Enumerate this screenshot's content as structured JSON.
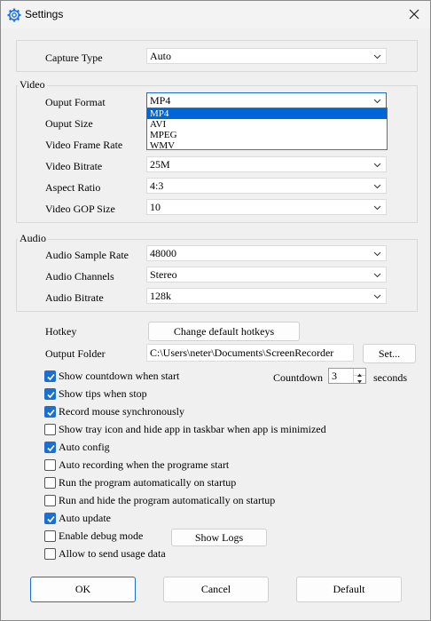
{
  "window": {
    "title": "Settings"
  },
  "capture": {
    "label": "Capture Type",
    "value": "Auto"
  },
  "video": {
    "group_label": "Video",
    "output_format": {
      "label": "Ouput Format",
      "value": "MP4",
      "options": [
        "MP4",
        "AVI",
        "MPEG",
        "WMV"
      ]
    },
    "output_size": {
      "label": "Ouput Size"
    },
    "frame_rate": {
      "label": "Video Frame Rate"
    },
    "bitrate": {
      "label": "Video Bitrate",
      "value": "25M"
    },
    "aspect_ratio": {
      "label": "Aspect Ratio",
      "value": "4:3"
    },
    "gop_size": {
      "label": "Video GOP Size",
      "value": "10"
    }
  },
  "audio": {
    "group_label": "Audio",
    "sample_rate": {
      "label": "Audio Sample Rate",
      "value": "48000"
    },
    "channels": {
      "label": "Audio Channels",
      "value": "Stereo"
    },
    "bitrate": {
      "label": "Audio Bitrate",
      "value": "128k"
    }
  },
  "hotkey": {
    "label": "Hotkey",
    "button": "Change default hotkeys"
  },
  "output_folder": {
    "label": "Output Folder",
    "value": "C:\\Users\\neter\\Documents\\ScreenRecorder",
    "button": "Set..."
  },
  "countdown": {
    "label": "Countdown",
    "value": "3",
    "unit": "seconds"
  },
  "options": [
    {
      "label": "Show countdown when start",
      "checked": true
    },
    {
      "label": "Show tips when stop",
      "checked": true
    },
    {
      "label": "Record mouse synchronously",
      "checked": true
    },
    {
      "label": "Show tray icon and hide app in taskbar when app is minimized",
      "checked": false
    },
    {
      "label": "Auto config",
      "checked": true
    },
    {
      "label": "Auto recording when the programe start",
      "checked": false
    },
    {
      "label": "Run the program automatically on startup",
      "checked": false
    },
    {
      "label": "Run and hide the program automatically on startup",
      "checked": false
    },
    {
      "label": "Auto update",
      "checked": true
    },
    {
      "label": "Enable debug mode",
      "checked": false
    },
    {
      "label": "Allow to send usage data",
      "checked": false
    }
  ],
  "show_logs": "Show Logs",
  "footer": {
    "ok": "OK",
    "cancel": "Cancel",
    "default": "Default"
  },
  "colors": {
    "accent": "#1c6fd1",
    "selection": "#0066d6",
    "background": "#f0f0f0"
  }
}
